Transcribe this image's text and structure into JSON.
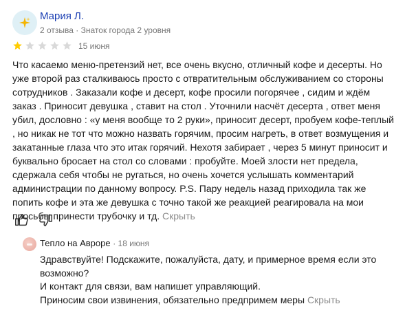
{
  "review": {
    "author": {
      "name": "Мария Л.",
      "meta": "2 отзыва · Знаток города 2 уровня",
      "avatar_icon": "sparkles-icon"
    },
    "rating": {
      "value": 1,
      "max": 5,
      "filled_color": "#fc0",
      "empty_color": "#d9d9d9"
    },
    "date": "15 июня",
    "text": "Что касаемо меню-претензий нет, все очень вкусно, отличный кофе и десерты. Но уже второй раз сталкиваюсь просто с отвратительным обслуживанием со стороны сотрудников . Заказали кофе и десерт, кофе просили погорячее , сидим и ждём заказ . Приносит девушка , ставит на стол . Уточнили насчёт десерта , ответ меня убил, дословно : «у меня вообще то 2 руки», приносит десерт, пробуем кофе-теплый , но никак не тот что можно назвать горячим, просим нагреть, в ответ возмущения и закатанные глаза что это итак горячий. Нехотя забирает , через 5 минут приносит и буквально бросает на стол со словами : пробуйте. Моей злости нет предела, сдержала себя чтобы не ругаться, но очень хочется услышать комментарий администрации по данному вопросу. P.S. Пару недель назад приходила так же попить кофе и эта же девушка с точно такой же реакцией реагировала на мои просьбы принести трубочку и тд.",
    "collapse_label": "Скрыть",
    "reactions": {
      "like_icon": "thumbs-up-icon",
      "dislike_icon": "thumbs-down-icon"
    }
  },
  "reply": {
    "org_name": "Тепло на Авроре",
    "date": "18 июня",
    "lines": [
      "Здравствуйте! Подскажите, пожалуйста, дату, и примерное время если это возможно?",
      "И контакт для связи, вам напишет управляющий.",
      "Приносим свои извинения, обязательно предпримем меры"
    ],
    "collapse_label": "Скрыть"
  }
}
